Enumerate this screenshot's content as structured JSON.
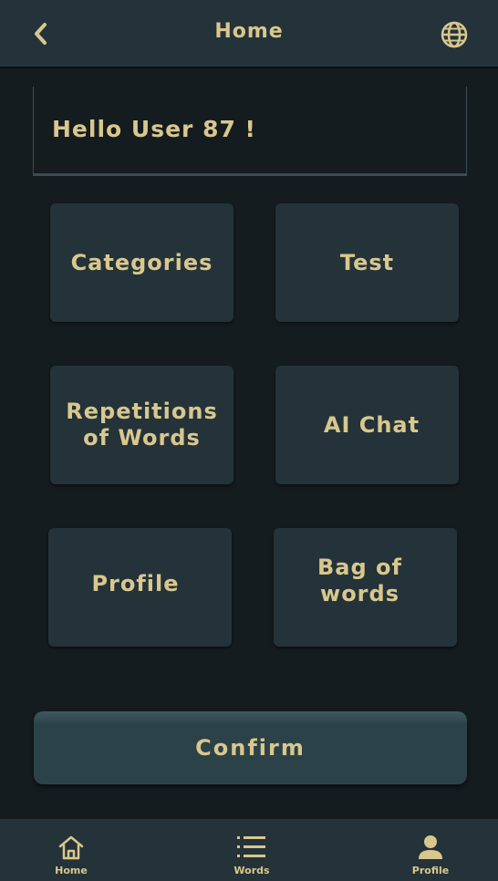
{
  "header": {
    "title": "Home",
    "back_icon": "chevron-left-icon",
    "language_icon": "globe-icon"
  },
  "greeting": "Hello User 87 !",
  "tiles": [
    {
      "label": "Categories"
    },
    {
      "label": "Test"
    },
    {
      "label": "Repetitions of Words"
    },
    {
      "label": "AI Chat"
    },
    {
      "label": "Profile"
    },
    {
      "label": "Bag of words"
    }
  ],
  "confirm_label": "Confirm",
  "bottom_nav": [
    {
      "label": "Home",
      "icon": "home-icon"
    },
    {
      "label": "Words",
      "icon": "list-icon"
    },
    {
      "label": "Profile",
      "icon": "person-icon"
    }
  ],
  "colors": {
    "accent": "#d9c78e",
    "background": "#151c1f",
    "surface": "#243339"
  }
}
